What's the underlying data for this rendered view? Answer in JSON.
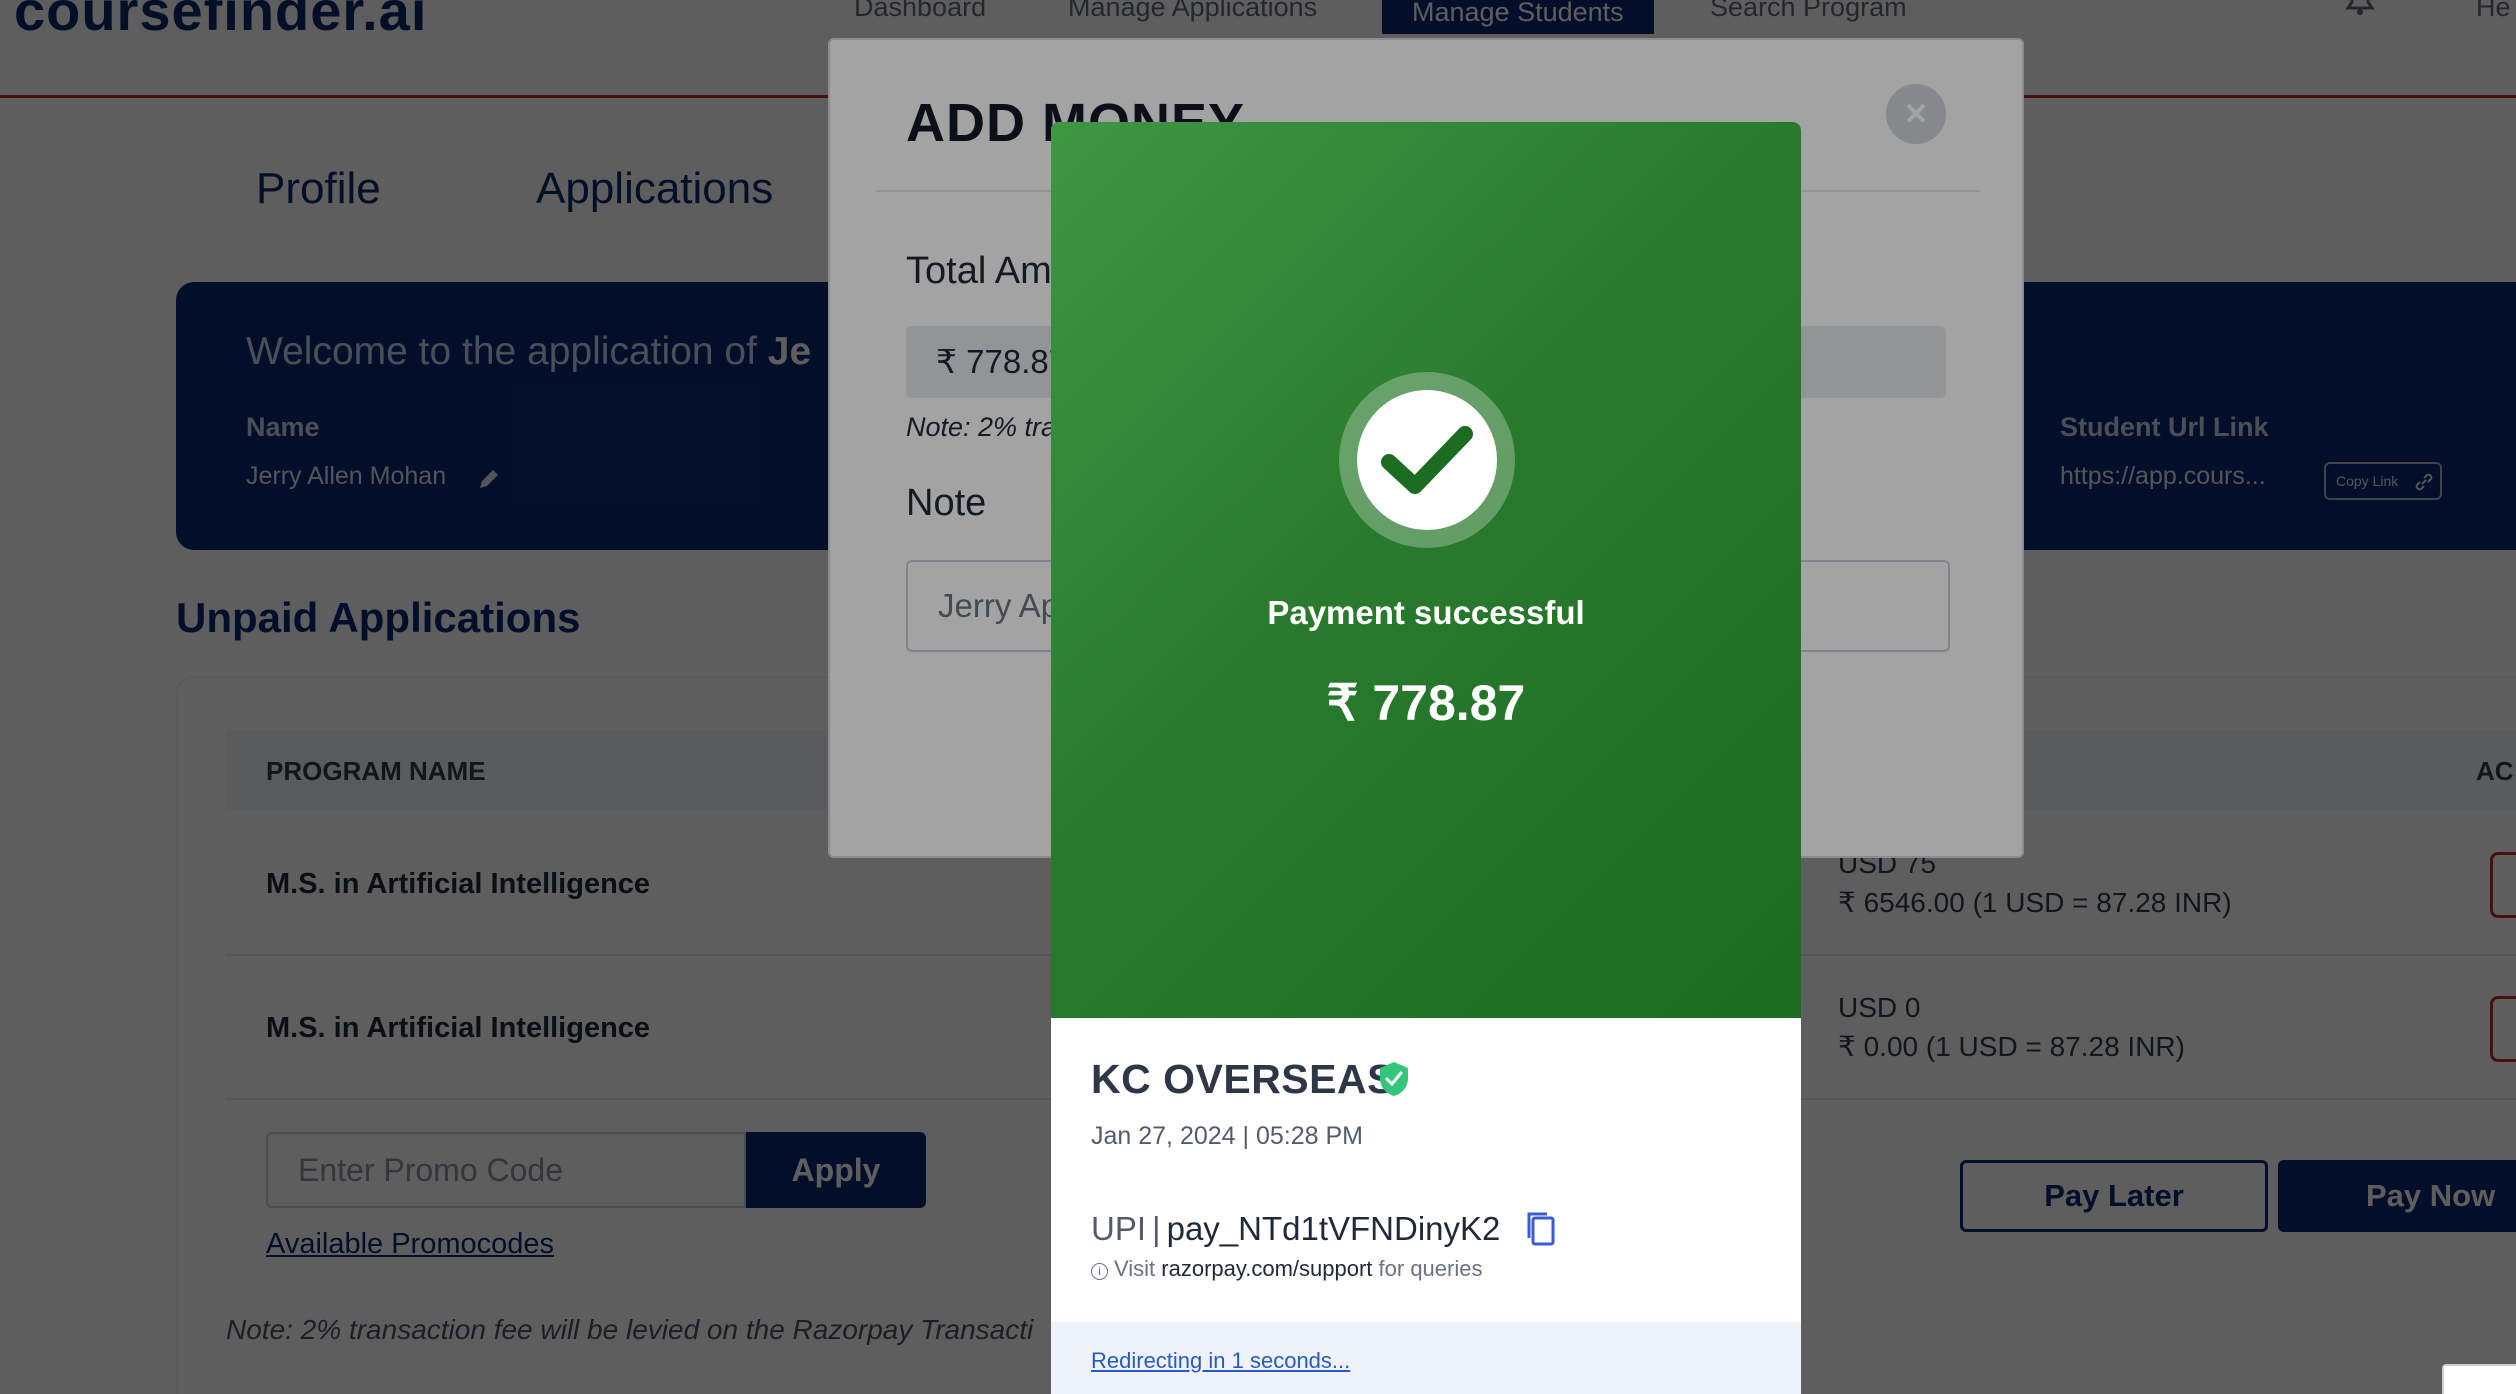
{
  "header": {
    "logo": "coursefinder.ai",
    "nav": [
      "Dashboard",
      "Manage Applications",
      "Manage Students",
      "Search Program"
    ],
    "active_nav": "Manage Students",
    "help": "He"
  },
  "tabs": [
    "Profile",
    "Applications"
  ],
  "welcome": {
    "prefix": "Welcome to the application of ",
    "name_part": "Je",
    "name_label": "Name",
    "name_value": "Jerry Allen Mohan",
    "url_label": "Student Url Link",
    "url_value": "https://app.cours...",
    "copy_link": "Copy Link"
  },
  "unpaid": {
    "title": "Unpaid Applications",
    "columns": [
      "PROGRAM NAME",
      "AC"
    ],
    "rows": [
      {
        "program": "M.S. in Artificial Intelligence",
        "usd": "USD 75",
        "inr": "₹ 6546.00 (1 USD = 87.28 INR)"
      },
      {
        "program": "M.S. in Artificial Intelligence",
        "usd": "USD 0",
        "inr": "₹ 0.00 (1 USD = 87.28 INR)"
      }
    ],
    "promo_placeholder": "Enter Promo Code",
    "apply": "Apply",
    "available_promocodes": "Available Promocodes",
    "fee_note": "Note: 2% transaction fee will be levied on the Razorpay Transacti",
    "pay_later": "Pay Later",
    "pay_now": "Pay Now"
  },
  "add_money_modal": {
    "title": "ADD MONEY",
    "close": "×",
    "total_label": "Total Am",
    "amount": "₹ 778.87",
    "note_fee": "Note: 2% tra",
    "note_label": "Note",
    "note_value": "Jerry Ap"
  },
  "razorpay": {
    "status": "Payment successful",
    "amount": "₹ 778.87",
    "merchant": "KC OVERSEAS",
    "datetime": "Jan 27, 2024 | 05:28 PM",
    "method": "UPI",
    "payment_id": "pay_NTd1tVFNDinyK2",
    "support_prefix": "Visit ",
    "support_link": "razorpay.com/support",
    "support_suffix": " for queries",
    "redirect": "Redirecting in 1 seconds...",
    "colors": {
      "success_green": "#2a7a2e",
      "check": "#1b6b21"
    },
    "icons": [
      "check-icon",
      "verified-shield-icon",
      "copy-icon",
      "info-icon"
    ]
  }
}
